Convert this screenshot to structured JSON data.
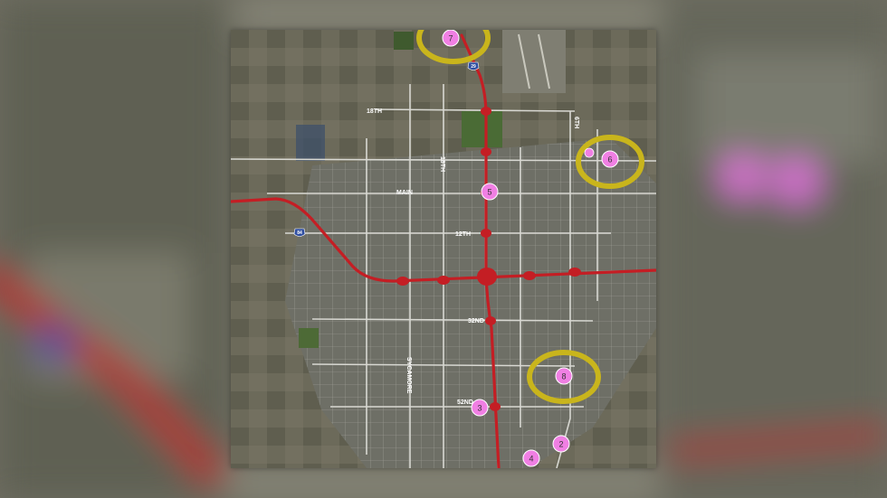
{
  "map": {
    "colors": {
      "highway": "#c41e24",
      "marker_fill": "#f07fe3",
      "marker_stroke": "#ffffff",
      "highlight_ring": "#c9b51c",
      "road": "#d8d8d2",
      "terrain": "#6b6a5b",
      "shield": "#2f4ea0"
    },
    "markers": [
      {
        "id": "2",
        "label": "2"
      },
      {
        "id": "3",
        "label": "3"
      },
      {
        "id": "4",
        "label": "4"
      },
      {
        "id": "5",
        "label": "5"
      },
      {
        "id": "6",
        "label": "6"
      },
      {
        "id": "7",
        "label": "7"
      },
      {
        "id": "8",
        "label": "8"
      }
    ],
    "highlighted_markers": [
      "6",
      "7",
      "8"
    ],
    "street_labels": {
      "main": "MAIN",
      "north_street": "18TH",
      "mid_street": "12TH",
      "south_street_1": "32ND",
      "south_street_2": "52ND",
      "vertical_street": "6TH",
      "upper_left_street": "18TH",
      "side_label": "SYCAMORE"
    },
    "shields": {
      "interstate_west": "84",
      "interstate_north": "29"
    }
  }
}
